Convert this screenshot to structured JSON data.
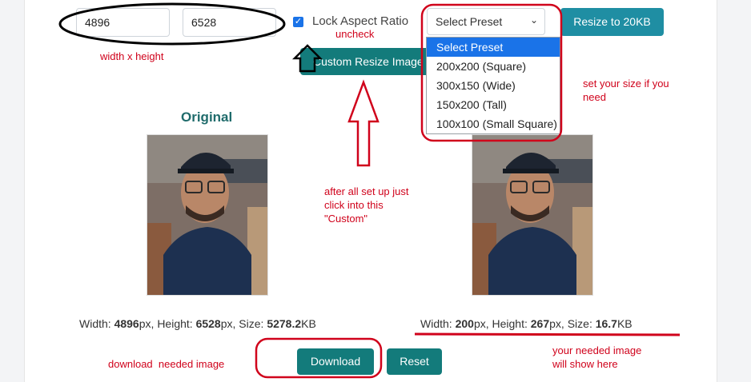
{
  "controls": {
    "width_value": "4896",
    "height_value": "6528",
    "lock_label": "Lock Aspect Ratio",
    "lock_checked": true,
    "preset_selected": "Select Preset",
    "preset_options": [
      "Select Preset",
      "200x200 (Square)",
      "300x150 (Wide)",
      "150x200 (Tall)",
      "100x100 (Small Square)"
    ],
    "resize20_label": "Resize to 20KB",
    "custom_label": "Custom Resize Image"
  },
  "original": {
    "heading": "Original",
    "width_label": "Width:",
    "width_value": "4896",
    "height_label": "Height:",
    "height_value": "6528",
    "size_label": "Size:",
    "size_value": "5278.2",
    "px_unit": "px",
    "kb_unit": "KB"
  },
  "resized": {
    "width_label": "Width:",
    "width_value": "200",
    "height_label": "Height:",
    "height_value": "267",
    "size_label": "Size:",
    "size_value": "16.7",
    "px_unit": "px",
    "kb_unit": "KB"
  },
  "actions": {
    "download_label": "Download",
    "reset_label": "Reset"
  },
  "annotations": {
    "width_height": "width x height",
    "uncheck": "uncheck",
    "set_size_1": "set your size if you",
    "set_size_2": "need",
    "after_1": "after all set up just",
    "after_2": "click into this",
    "after_3": "\"Custom\"",
    "needed_1": "your needed image",
    "needed_2": "will show here",
    "download_note": "download  needed image"
  },
  "colors": {
    "primary_button": "#137b7b",
    "secondary_button": "#1f8ea3",
    "annotation_red": "#d0021b",
    "heading_teal": "#1f6b6b"
  }
}
